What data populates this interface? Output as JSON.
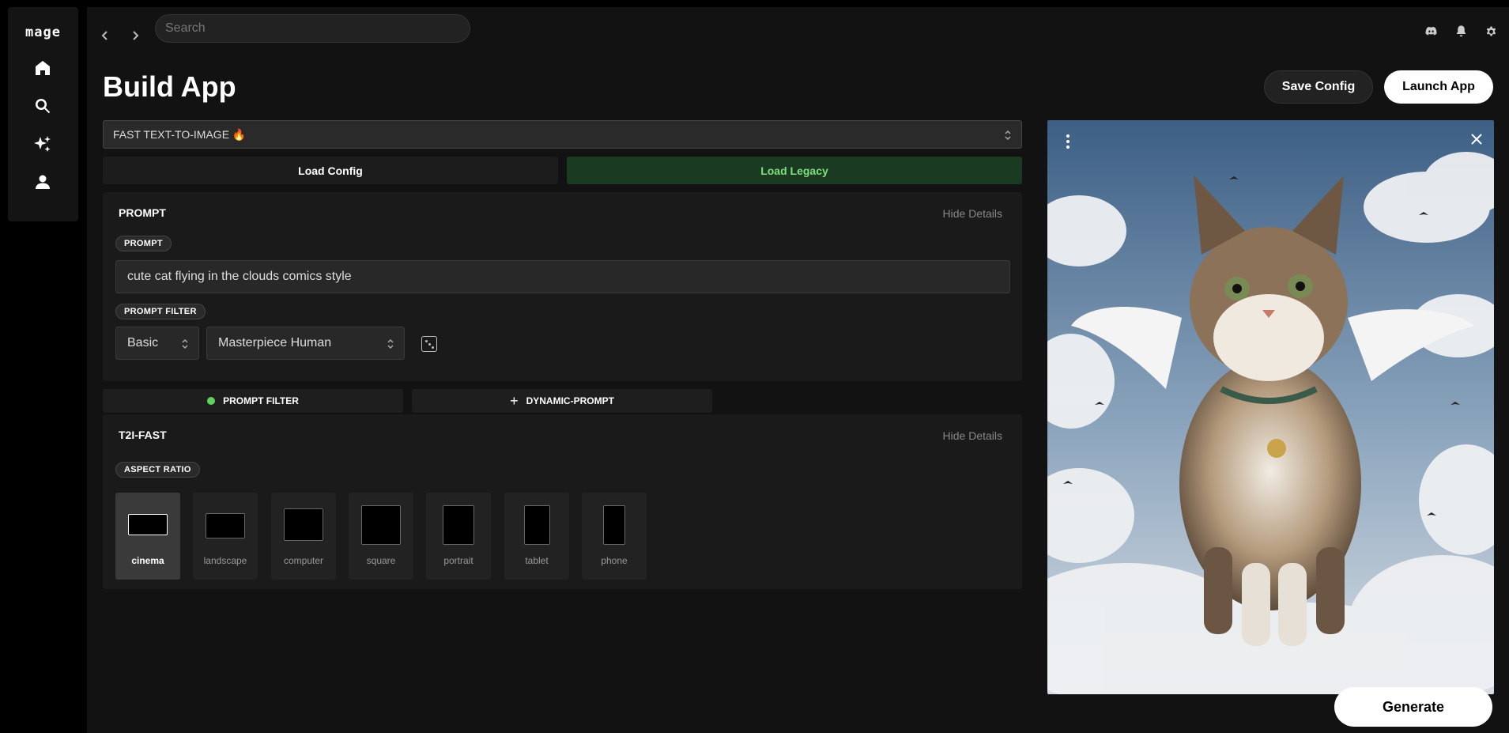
{
  "app": {
    "logo": "mage"
  },
  "rail": {
    "items": [
      "home-icon",
      "search-icon",
      "sparkles-icon",
      "user-icon"
    ]
  },
  "topbar": {
    "search_placeholder": "Search",
    "icons": [
      "discord-icon",
      "bell-icon",
      "gear-icon"
    ]
  },
  "header": {
    "title": "Build App",
    "save_label": "Save Config",
    "launch_label": "Launch App"
  },
  "model": {
    "selected": "FAST TEXT-TO-IMAGE 🔥"
  },
  "load": {
    "config_label": "Load Config",
    "legacy_label": "Load Legacy"
  },
  "prompt_card": {
    "title": "PROMPT",
    "hide_label": "Hide Details",
    "prompt_pill": "PROMPT",
    "prompt_value": "cute cat flying in the clouds comics style",
    "filter_pill": "PROMPT FILTER",
    "filter_level": "Basic",
    "filter_style": "Masterpiece Human"
  },
  "toggles": {
    "prompt_filter": "PROMPT FILTER",
    "dynamic_prompt": "DYNAMIC-PROMPT"
  },
  "t2i_card": {
    "title": "T2I-FAST",
    "hide_label": "Hide Details",
    "aspect_pill": "ASPECT RATIO",
    "ratios": [
      {
        "label": "cinema",
        "selected": true
      },
      {
        "label": "landscape",
        "selected": false
      },
      {
        "label": "computer",
        "selected": false
      },
      {
        "label": "square",
        "selected": false
      },
      {
        "label": "portrait",
        "selected": false
      },
      {
        "label": "tablet",
        "selected": false
      },
      {
        "label": "phone",
        "selected": false
      }
    ]
  },
  "preview": {
    "generate_label": "Generate"
  },
  "colors": {
    "accent_green": "#5fd15f",
    "legacy_bg": "#1a3a22",
    "legacy_text": "#7ee07e"
  }
}
